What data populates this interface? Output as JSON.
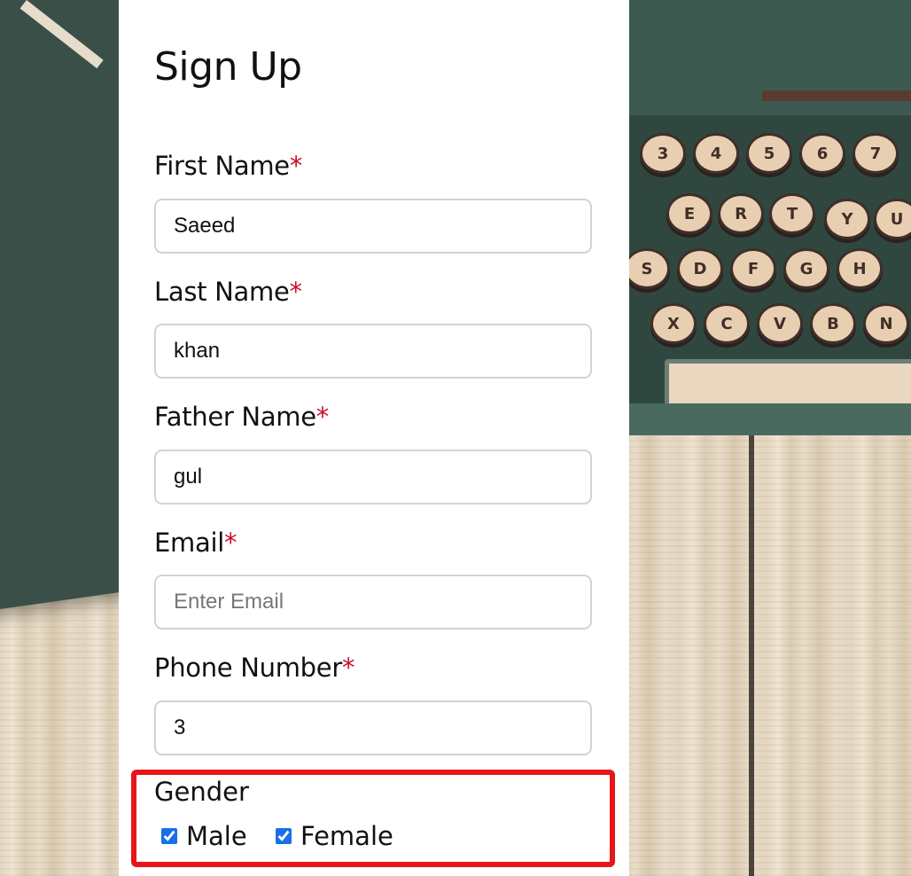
{
  "form": {
    "title": "Sign Up",
    "required_mark": "*",
    "fields": [
      {
        "label": "First Name",
        "value": "Saeed",
        "placeholder": ""
      },
      {
        "label": "Last Name",
        "value": "khan",
        "placeholder": ""
      },
      {
        "label": "Father Name",
        "value": "gul",
        "placeholder": ""
      },
      {
        "label": "Email",
        "value": "",
        "placeholder": "Enter Email"
      },
      {
        "label": "Phone Number",
        "value": "3",
        "placeholder": ""
      }
    ],
    "gender": {
      "label": "Gender",
      "options": [
        {
          "label": "Male",
          "checked": true
        },
        {
          "label": "Female",
          "checked": true
        }
      ]
    }
  },
  "background": {
    "keys_row1": [
      "3",
      "4",
      "5",
      "6",
      "7"
    ],
    "keys_row2": [
      "E",
      "R",
      "T",
      "Y",
      "U"
    ],
    "keys_row3": [
      "S",
      "D",
      "F",
      "G",
      "H"
    ],
    "keys_row4": [
      "X",
      "C",
      "V",
      "B",
      "N"
    ]
  },
  "colors": {
    "required": "#c8102e",
    "highlight_border": "#e8161b",
    "checkbox": "#1a6ee8"
  }
}
